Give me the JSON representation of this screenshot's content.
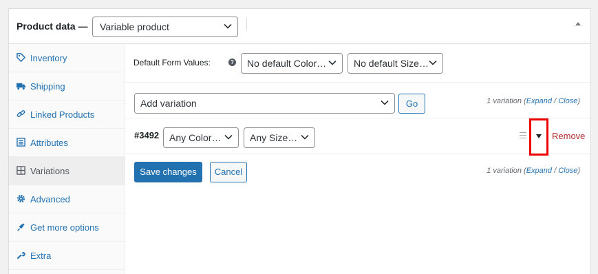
{
  "header": {
    "title": "Product data —",
    "product_type": "Variable product"
  },
  "tabs": [
    {
      "label": "Inventory",
      "icon": "tag-icon"
    },
    {
      "label": "Shipping",
      "icon": "truck-icon"
    },
    {
      "label": "Linked Products",
      "icon": "link-icon"
    },
    {
      "label": "Attributes",
      "icon": "list-icon"
    },
    {
      "label": "Variations",
      "icon": "grid-icon",
      "active": true
    },
    {
      "label": "Advanced",
      "icon": "gear-icon"
    },
    {
      "label": "Get more options",
      "icon": "plugin-icon"
    },
    {
      "label": "Extra",
      "icon": "wrench-icon"
    }
  ],
  "defaults": {
    "label": "Default Form Values:",
    "help": "?",
    "color_select": "No default Color…",
    "size_select": "No default Size…"
  },
  "add": {
    "select": "Add variation",
    "go_label": "Go"
  },
  "count": {
    "text": "1 variation",
    "open": "(",
    "expand": "Expand",
    "sep": " / ",
    "close": "Close",
    "end": ")"
  },
  "variation": {
    "id": "#3492",
    "color": "Any Color…",
    "size": "Any Size…",
    "remove": "Remove"
  },
  "actions": {
    "save": "Save changes",
    "cancel": "Cancel"
  },
  "colors": {
    "link": "#2271b1",
    "primary_button": "#2271b1",
    "remove": "#b32d2e",
    "highlight": "#ee0000"
  }
}
